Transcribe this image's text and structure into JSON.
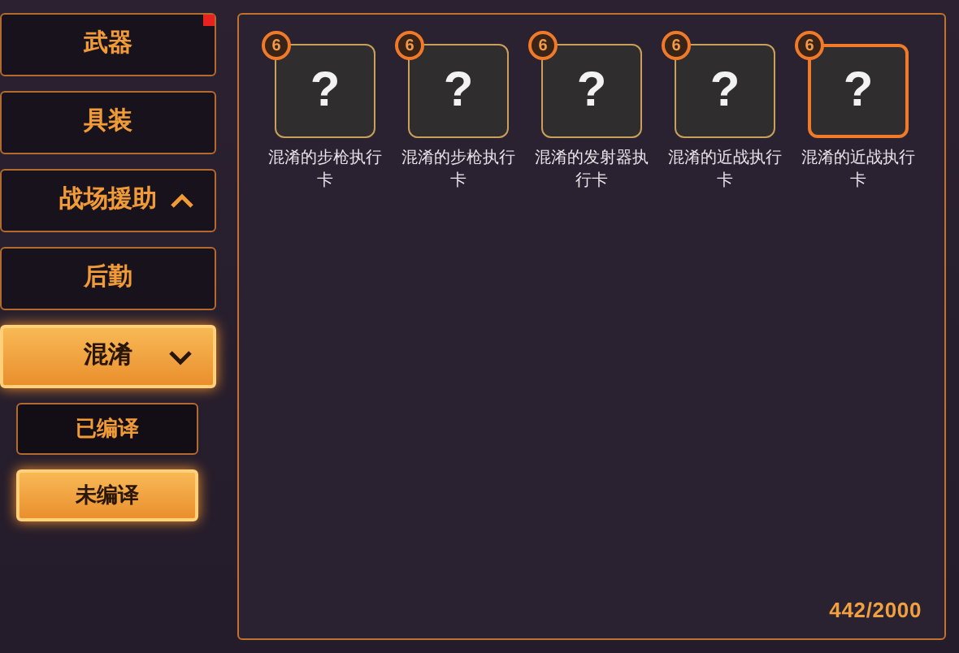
{
  "sidebar": {
    "items": [
      {
        "kind": "tab",
        "label": "武器",
        "selected": false,
        "notification": true
      },
      {
        "kind": "tab",
        "label": "具装",
        "selected": false
      },
      {
        "kind": "group",
        "label": "战场援助",
        "selected": false,
        "expanded": false
      },
      {
        "kind": "tab",
        "label": "后勤",
        "selected": false
      },
      {
        "kind": "group",
        "label": "混淆",
        "selected": true,
        "expanded": true,
        "children": [
          {
            "label": "已编译",
            "selected": false
          },
          {
            "label": "未编译",
            "selected": true
          }
        ]
      }
    ]
  },
  "cards": [
    {
      "badge": "6",
      "symbol": "?",
      "name": "混淆的步枪执行卡",
      "selected": false
    },
    {
      "badge": "6",
      "symbol": "?",
      "name": "混淆的步枪执行卡",
      "selected": false
    },
    {
      "badge": "6",
      "symbol": "?",
      "name": "混淆的发射器执行卡",
      "selected": false
    },
    {
      "badge": "6",
      "symbol": "?",
      "name": "混淆的近战执行卡",
      "selected": false
    },
    {
      "badge": "6",
      "symbol": "?",
      "name": "混淆的近战执行卡",
      "selected": true
    }
  ],
  "counter": "442/2000"
}
